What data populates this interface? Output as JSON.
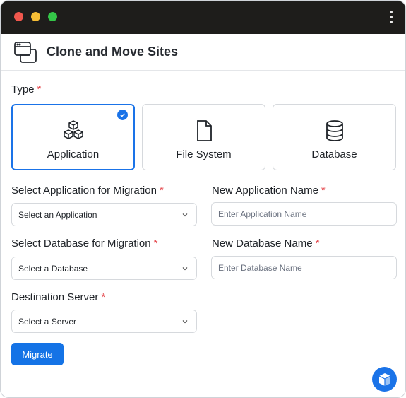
{
  "header": {
    "title": "Clone and Move Sites"
  },
  "type_section": {
    "label": "Type",
    "required_mark": "*",
    "options": [
      {
        "label": "Application",
        "icon": "cubes-icon",
        "selected": true
      },
      {
        "label": "File System",
        "icon": "file-icon",
        "selected": false
      },
      {
        "label": "Database",
        "icon": "database-icon",
        "selected": false
      }
    ]
  },
  "form": {
    "app_select": {
      "label": "Select Application for Migration",
      "required_mark": "*",
      "value": "Select an Application"
    },
    "app_name": {
      "label": "New Application Name",
      "required_mark": "*",
      "placeholder": "Enter Application Name"
    },
    "db_select": {
      "label": "Select Database for Migration",
      "required_mark": "*",
      "value": "Select a Database"
    },
    "db_name": {
      "label": "New Database Name",
      "required_mark": "*",
      "placeholder": "Enter Database Name"
    },
    "server_select": {
      "label": "Destination Server",
      "required_mark": "*",
      "value": "Select a Server"
    }
  },
  "actions": {
    "migrate_label": "Migrate"
  },
  "colors": {
    "accent": "#1a73e8",
    "required": "#e5484d",
    "titlebar": "#1e1d1b"
  }
}
